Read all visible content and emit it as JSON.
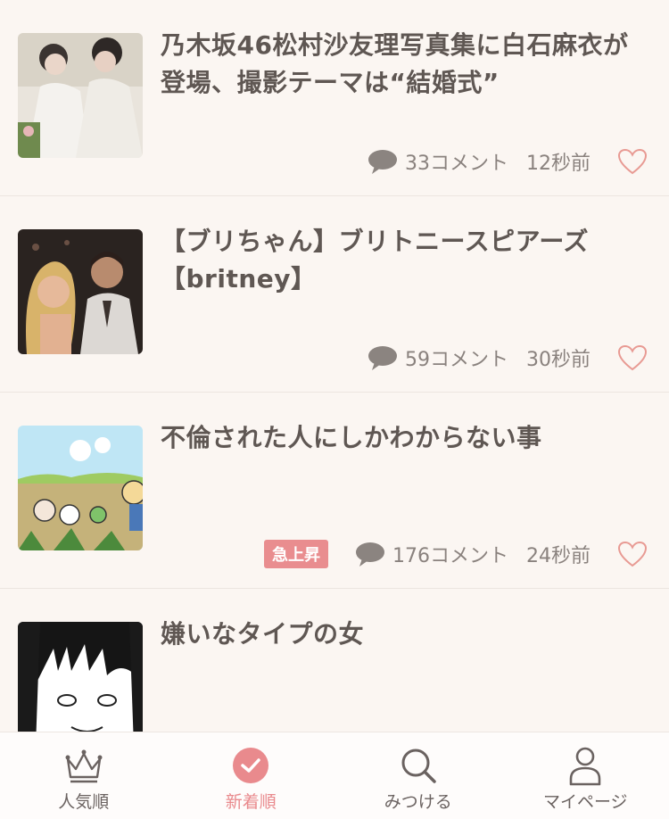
{
  "articles": [
    {
      "title": "乃木坂46松村沙友理写真集に白石麻衣が登場、撮影テーマは“結婚式”",
      "comments": "33コメント",
      "time": "12秒前",
      "thumb": "wedding-photo"
    },
    {
      "title": "【ブリちゃん】ブリトニースピアーズ【britney】",
      "comments": "59コメント",
      "time": "30秒前",
      "thumb": "britney-photo"
    },
    {
      "title": "不倫された人にしかわからない事",
      "badge": "急上昇",
      "comments": "176コメント",
      "time": "24秒前",
      "thumb": "cartoon-animals"
    },
    {
      "title": "嫌いなタイプの女",
      "thumb": "manga-girl"
    }
  ],
  "tabbar": {
    "tabs": [
      {
        "label": "人気順",
        "icon": "crown-icon"
      },
      {
        "label": "新着順",
        "icon": "check-circle-icon"
      },
      {
        "label": "みつける",
        "icon": "search-icon"
      },
      {
        "label": "マイページ",
        "icon": "person-icon"
      }
    ],
    "active_index": 1
  },
  "colors": {
    "background": "#fbf6f2",
    "accent": "#e98a8d",
    "text": "#5f5753",
    "muted": "#8a827e"
  }
}
